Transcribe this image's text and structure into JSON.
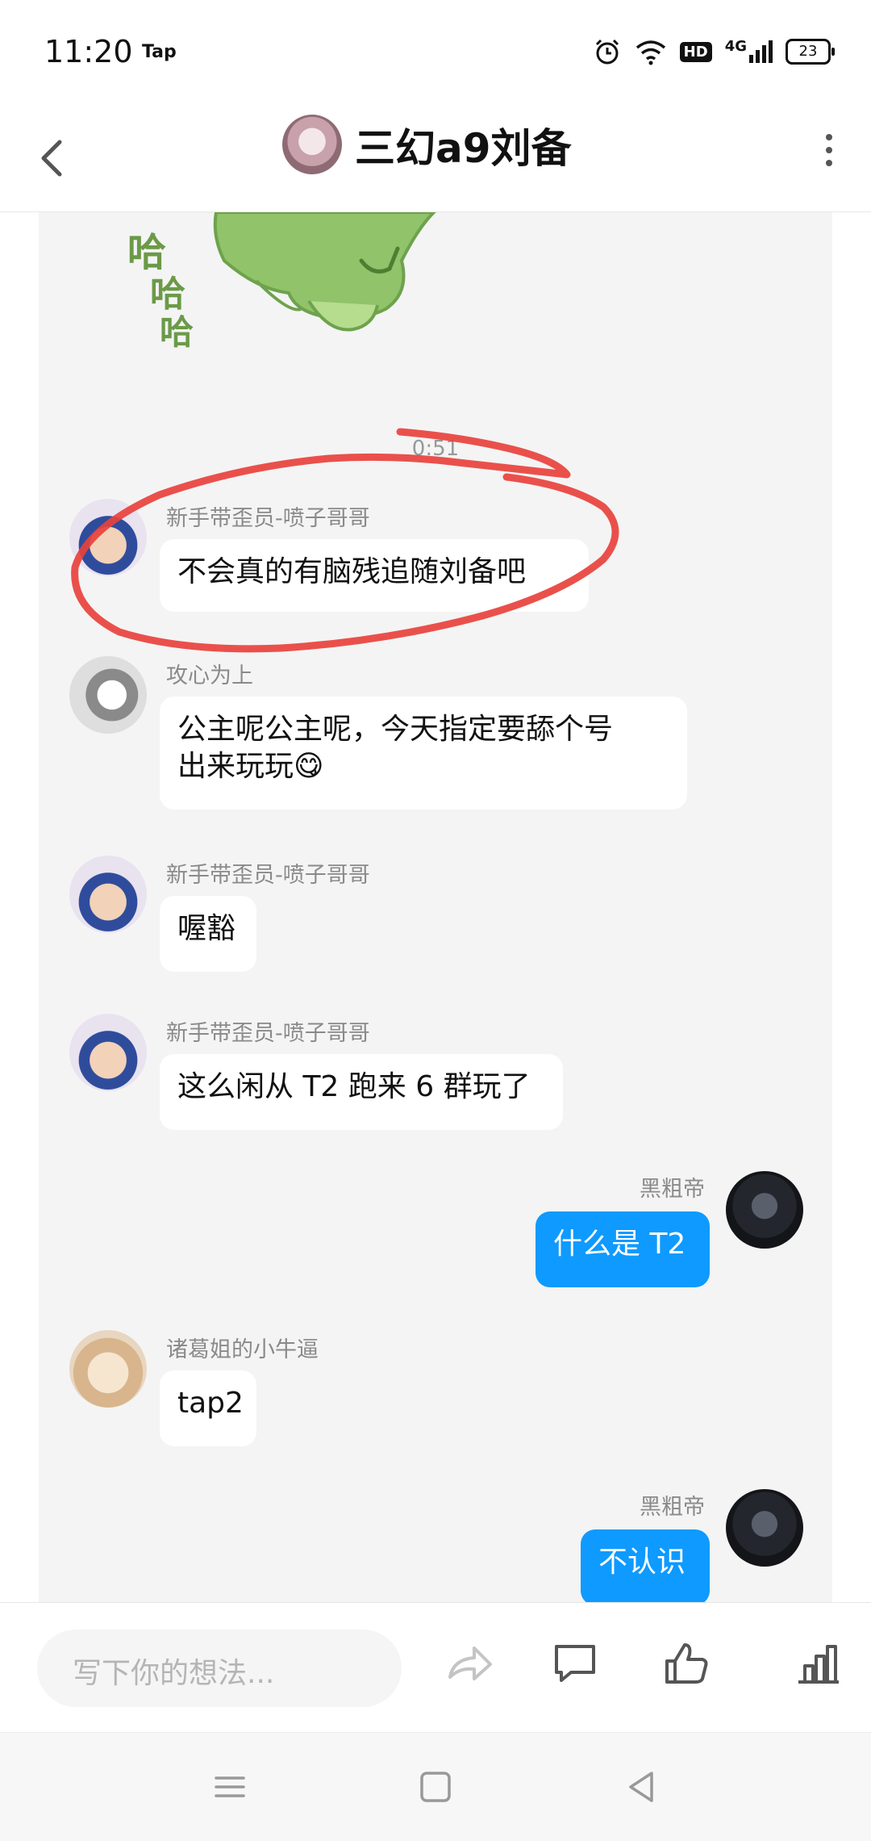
{
  "status_bar": {
    "time": "11:20",
    "app_label": "Tap",
    "hd": "HD",
    "network": "4G",
    "battery": "23"
  },
  "header": {
    "title": "三幻a9刘备"
  },
  "chat": {
    "timestamp": "0:51",
    "sticker_text": [
      "哈",
      "哈",
      "哈"
    ],
    "messages": [
      {
        "sender": "新手带歪员-喷子哥哥",
        "text": "不会真的有脑残追随刘备吧",
        "side": "in"
      },
      {
        "sender": "攻心为上",
        "text_line1": "公主呢公主呢，今天指定要舔个号",
        "text_line2": "出来玩玩😋",
        "side": "in"
      },
      {
        "sender": "新手带歪员-喷子哥哥",
        "text": "喔豁",
        "side": "in"
      },
      {
        "sender": "新手带歪员-喷子哥哥",
        "text": "这么闲从 T2 跑来 6 群玩了",
        "side": "in"
      },
      {
        "sender": "黑粗帝",
        "text": "什么是 T2",
        "side": "out"
      },
      {
        "sender": "诸葛姐的小牛逼",
        "text": "tap2",
        "side": "in"
      },
      {
        "sender": "黑粗帝",
        "text": "不认识",
        "side": "out"
      }
    ]
  },
  "input_bar": {
    "placeholder": "写下你的想法..."
  },
  "colors": {
    "outgoing_bubble": "#0f9aff",
    "annotation": "#e8413c",
    "chat_bg": "#f4f4f4"
  },
  "icons": [
    "back-arrow-icon",
    "more-icon",
    "share-icon",
    "comment-icon",
    "like-icon",
    "stats-icon",
    "menu-icon",
    "home-icon",
    "back-icon"
  ]
}
